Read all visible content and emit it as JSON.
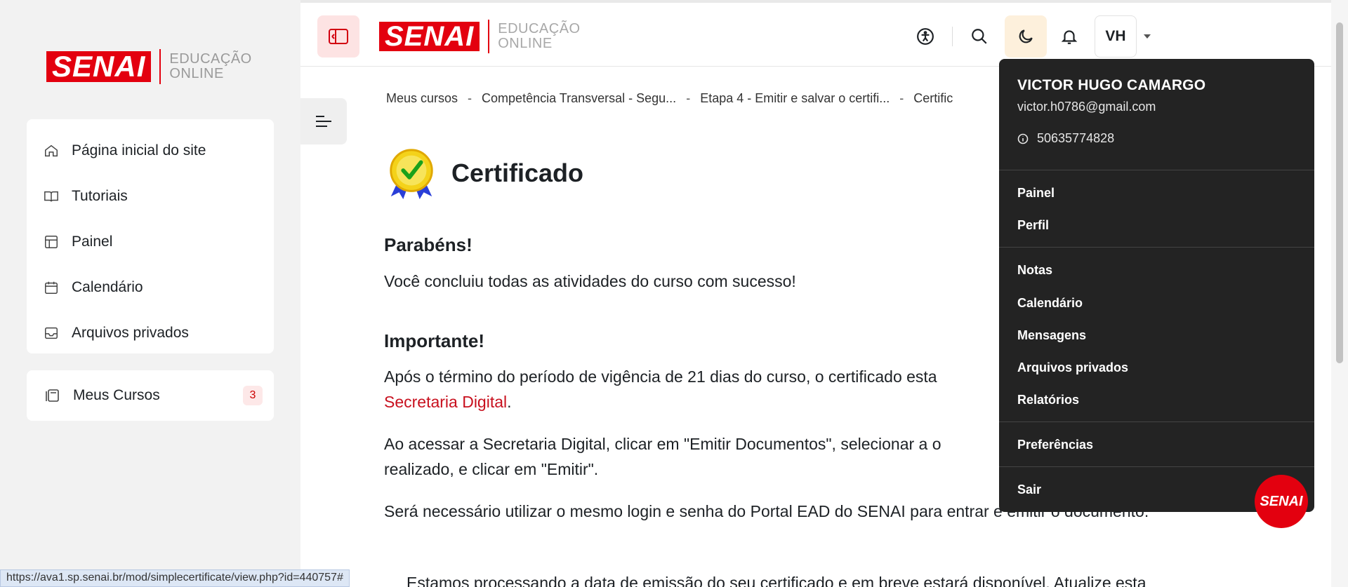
{
  "sidebar": {
    "brand": {
      "logo": "SENAI",
      "sub_line1": "EDUCAÇÃO",
      "sub_line2": "ONLINE"
    },
    "items": [
      {
        "label": "Página inicial do site",
        "icon": "home-icon"
      },
      {
        "label": "Tutoriais",
        "icon": "book-icon"
      },
      {
        "label": "Painel",
        "icon": "dashboard-icon"
      },
      {
        "label": "Calendário",
        "icon": "calendar-icon"
      },
      {
        "label": "Arquivos privados",
        "icon": "inbox-icon"
      }
    ],
    "courses": {
      "label": "Meus Cursos",
      "count": "3",
      "icon": "courses-icon"
    }
  },
  "topbar": {
    "brand": {
      "logo": "SENAI",
      "sub_line1": "EDUCAÇÃO",
      "sub_line2": "ONLINE"
    },
    "avatar_initials": "VH",
    "accent_color": "#e3000f"
  },
  "breadcrumb": [
    "Meus cursos",
    "Competência Transversal - Segu...",
    "Etapa 4 - Emitir e salvar o certifi...",
    "Certific"
  ],
  "breadcrumb_sep": "-",
  "main": {
    "title": "Certificado",
    "congrats_heading": "Parabéns!",
    "congrats_text": "Você concluiu todas as atividades do curso com sucesso!",
    "important_heading": "Importante!",
    "important_text": "Após o término do período de vigência de 21 dias do curso, o certificado esta",
    "secretaria_link": "Secretaria Digital",
    "secretaria_period": ".",
    "access_line1": "Ao acessar a Secretaria Digital, clicar em \"Emitir Documentos\", selecionar a o",
    "access_line2": "realizado, e clicar em \"Emitir\".",
    "login_text": "Será necessário utilizar o mesmo login e senha do Portal EAD do SENAI para entrar e emitir o documento.",
    "processing_text": "Estamos processando a data de emissão do seu certificado e em breve estará disponível. Atualize esta"
  },
  "user_menu": {
    "name": "VICTOR HUGO CAMARGO",
    "email": "victor.h0786@gmail.com",
    "id": "50635774828",
    "items": [
      "Painel",
      "Perfil",
      "Notas",
      "Calendário",
      "Mensagens",
      "Arquivos privados",
      "Relatórios",
      "Preferências",
      "Sair"
    ]
  },
  "fab_label": "SENAI",
  "status_url": "https://ava1.sp.senai.br/mod/simplecertificate/view.php?id=440757#"
}
